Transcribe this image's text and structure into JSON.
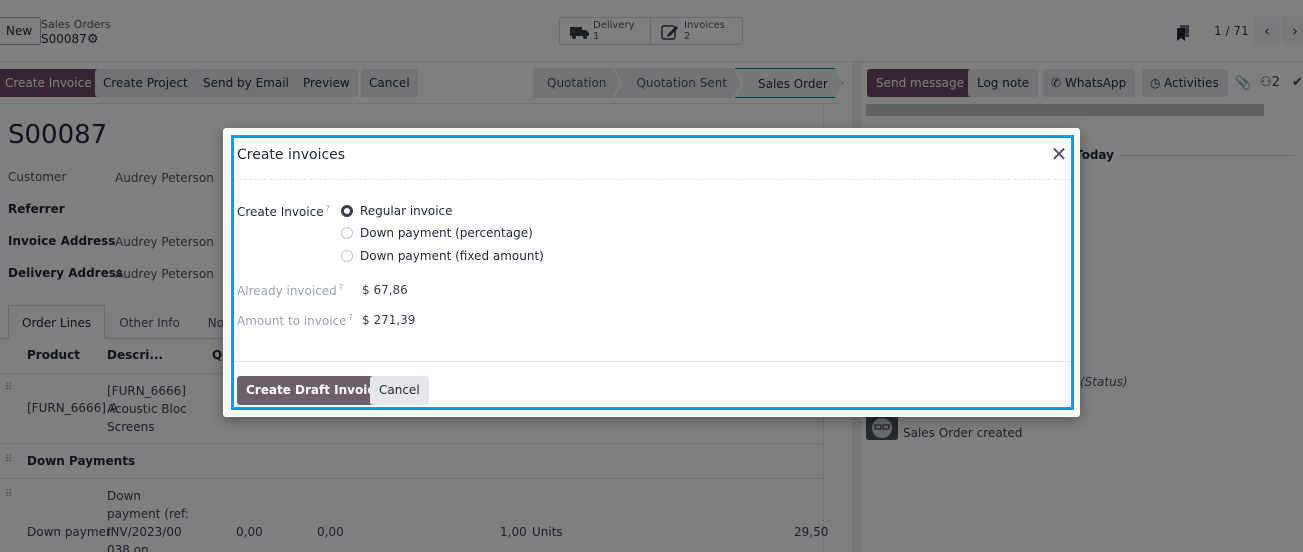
{
  "control_panel": {
    "new_label": "New",
    "breadcrumb_parent": "Sales Orders",
    "breadcrumb_current": "S00087",
    "smart_buttons": [
      {
        "icon": "truck-icon",
        "label": "Delivery",
        "value": "1"
      },
      {
        "icon": "edit-icon",
        "label": "Invoices",
        "value": "2"
      }
    ],
    "pager": "1 / 71"
  },
  "action_buttons": [
    "Create Invoice",
    "Create Project",
    "Send by Email",
    "Preview",
    "Cancel"
  ],
  "status_stages": [
    "Quotation",
    "Quotation Sent",
    "Sales Order"
  ],
  "active_stage": "Sales Order",
  "record": {
    "name": "S00087",
    "fields": [
      {
        "label": "Customer",
        "value": "Audrey Peterson",
        "bold": false
      },
      {
        "label": "Referrer",
        "value": "",
        "bold": true
      },
      {
        "label": "Invoice Address",
        "value": "Audrey Peterson",
        "bold": true
      },
      {
        "label": "Delivery Address",
        "value": "Audrey Peterson",
        "bold": true
      }
    ],
    "tabs": [
      "Order Lines",
      "Other Info",
      "Notes"
    ],
    "columns": [
      "Product",
      "Descri...",
      "Q"
    ],
    "lines": {
      "line1_product": "[FURN_6666] A",
      "line1_desc": [
        "[FURN_6666]",
        "Acoustic Bloc",
        "Screens"
      ],
      "section": "Down Payments",
      "line2_product": "Down paymer",
      "line2_desc": [
        "Down",
        "payment (ref:",
        "INV/2023/00",
        "038 on"
      ],
      "line2_values": [
        "0,00",
        "0,00",
        "1,00",
        "Units",
        "29,50"
      ]
    }
  },
  "chatter": {
    "buttons": [
      "Send message",
      "Log note",
      "WhatsApp",
      "Activities"
    ],
    "followers": "2",
    "date_separator": "Today",
    "status_text": "(Status)",
    "message": "Sales Order created"
  },
  "modal": {
    "title": "Create invoices",
    "create_invoice_label": "Create Invoice",
    "options": [
      {
        "label": "Regular invoice",
        "checked": true
      },
      {
        "label": "Down payment (percentage)",
        "checked": false
      },
      {
        "label": "Down payment (fixed amount)",
        "checked": false
      }
    ],
    "already_invoiced_label": "Already invoiced",
    "already_invoiced_value": "$ 67,86",
    "amount_to_invoice_label": "Amount to invoice",
    "amount_to_invoice_value": "$ 271,39",
    "primary_button": "Create Draft Invoice",
    "secondary_button": "Cancel",
    "help_mark": "?"
  },
  "colors": {
    "brand": "#714b67",
    "highlight": "#00a1e4",
    "active_stage": "#017e84"
  }
}
